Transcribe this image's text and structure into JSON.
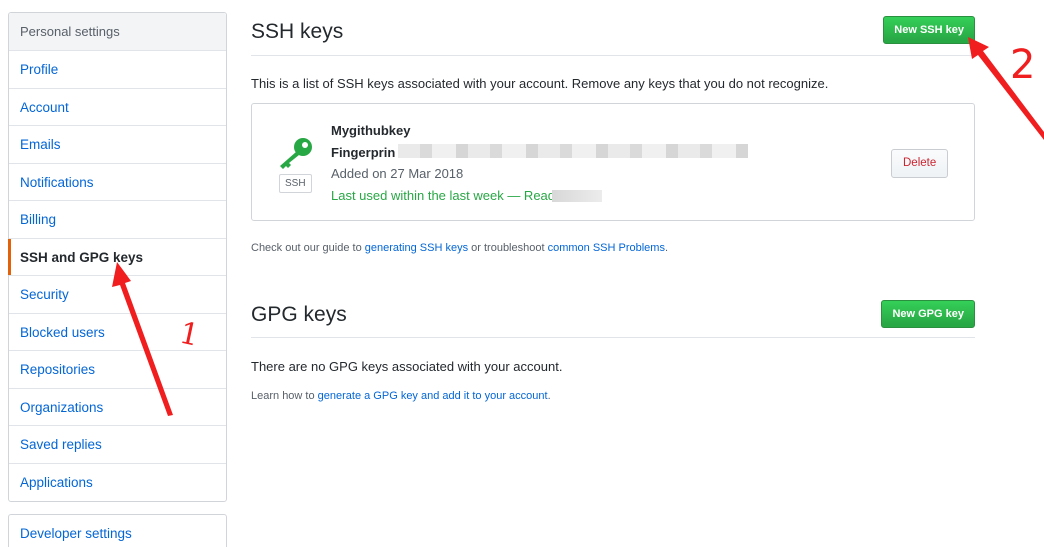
{
  "sidebar": {
    "header": "Personal settings",
    "items": [
      {
        "label": "Profile"
      },
      {
        "label": "Account"
      },
      {
        "label": "Emails"
      },
      {
        "label": "Notifications"
      },
      {
        "label": "Billing"
      },
      {
        "label": "SSH and GPG keys",
        "selected": true
      },
      {
        "label": "Security"
      },
      {
        "label": "Blocked users"
      },
      {
        "label": "Repositories"
      },
      {
        "label": "Organizations"
      },
      {
        "label": "Saved replies"
      },
      {
        "label": "Applications"
      }
    ],
    "developer_settings": "Developer settings"
  },
  "ssh": {
    "title": "SSH keys",
    "new_button": "New SSH key",
    "description": "This is a list of SSH keys associated with your account. Remove any keys that you do not recognize.",
    "key": {
      "name": "Mygithubkey",
      "fingerprint_label": "Fingerprin",
      "added": "Added on 27 Mar 2018",
      "last_used": "Last used within the last week — Read/write",
      "badge": "SSH",
      "delete_label": "Delete"
    },
    "guide_prefix": "Check out our guide to ",
    "guide_link1": "generating SSH keys",
    "guide_middle": " or troubleshoot ",
    "guide_link2": "common SSH Problems",
    "guide_suffix": "."
  },
  "gpg": {
    "title": "GPG keys",
    "new_button": "New GPG key",
    "description": "There are no GPG keys associated with your account.",
    "guide_prefix": "Learn how to ",
    "guide_link": "generate a GPG key and add it to your account",
    "guide_suffix": "."
  },
  "annotations": {
    "label1": "1",
    "label2": "2",
    "color": "#f01e1e"
  },
  "colors": {
    "link": "#0366d6",
    "accent_green": "#28a745",
    "selected_bar": "#e36209",
    "delete_red": "#cb2431"
  }
}
